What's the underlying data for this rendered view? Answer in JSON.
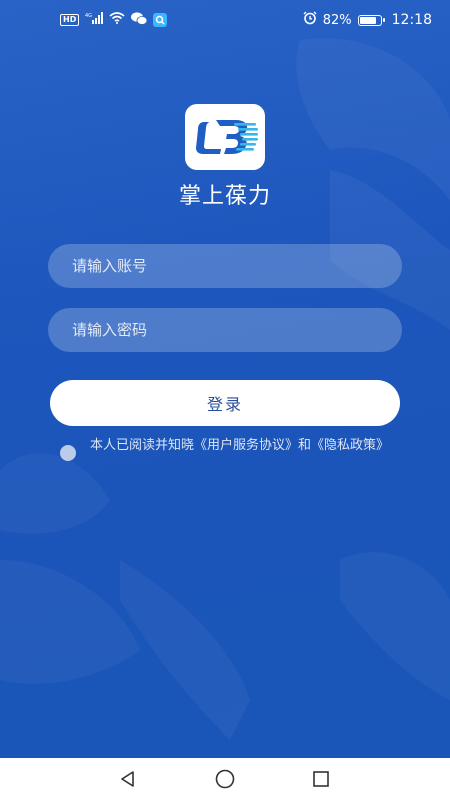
{
  "status_bar": {
    "hd_badge": "HD",
    "network": "4G",
    "battery_percent": "82%",
    "battery_level": 0.82,
    "time": "12:18"
  },
  "app": {
    "name": "掌上葆力",
    "logo_icon": "lb-logo-icon"
  },
  "form": {
    "account_placeholder": "请输入账号",
    "password_placeholder": "请输入密码",
    "account_value": "",
    "password_value": "",
    "login_label": "登录"
  },
  "agreement": {
    "text": "本人已阅读并知晓《用户服务协议》和《隐私政策》",
    "checked": false
  },
  "nav_bar": {
    "back_icon": "triangle-back-icon",
    "home_icon": "circle-home-icon",
    "recents_icon": "square-recents-icon"
  },
  "colors": {
    "background": "#1d57bd",
    "button_text": "#2a4f9a",
    "logo_blue": "#1f5fc4",
    "logo_cyan": "#38b6ea"
  }
}
